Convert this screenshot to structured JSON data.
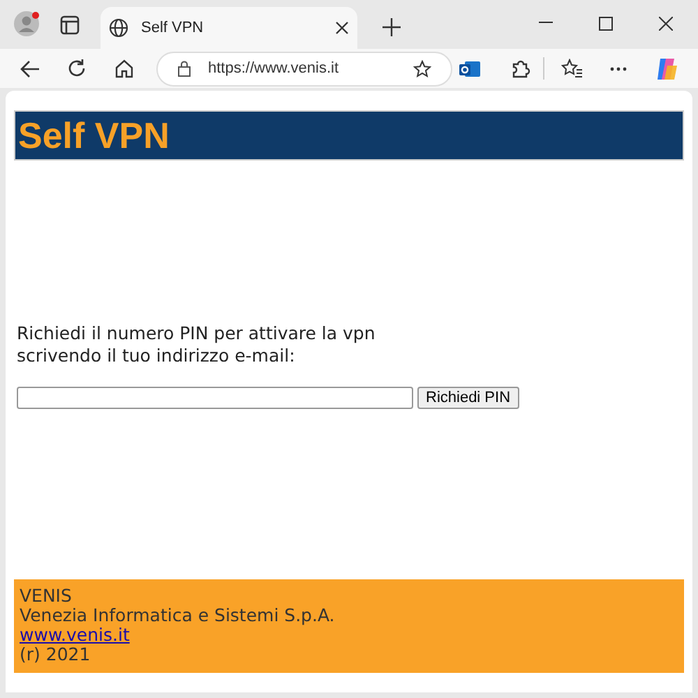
{
  "browser": {
    "tab": {
      "title": "Self VPN",
      "selected": true
    },
    "address": "https://www.venis.it"
  },
  "page": {
    "header": "Self VPN",
    "prompt": [
      "Richiedi il numero PIN per attivare la vpn",
      "scrivendo il tuo indirizzo e-mail:"
    ],
    "button": "Richiedi PIN",
    "footer": [
      {
        "kind": "text",
        "text": "VENIS"
      },
      {
        "kind": "text",
        "text": "Venezia Informatica e Sistemi S.p.A."
      },
      {
        "kind": "link",
        "text": "www.venis.it"
      },
      {
        "kind": "text",
        "text": "(r) 2021"
      }
    ]
  }
}
